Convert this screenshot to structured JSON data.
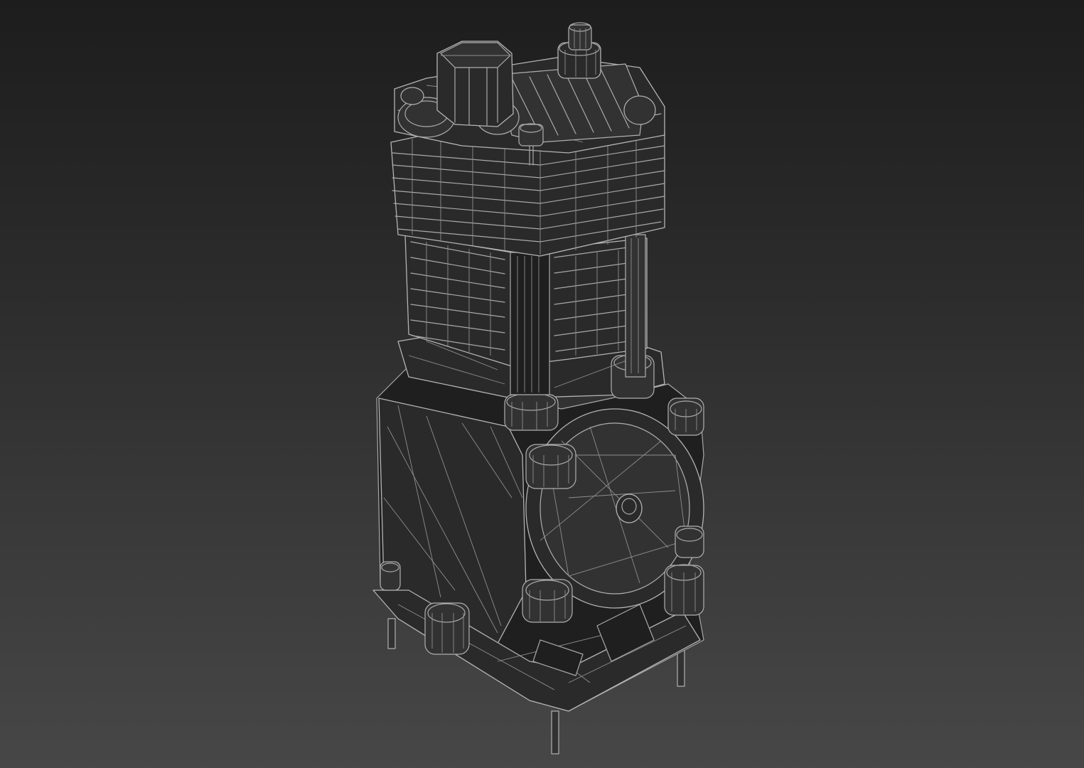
{
  "scene": {
    "subject": "compressor-wireframe",
    "colors": {
      "background_top": "#1d1d1d",
      "background_bottom": "#474747",
      "wire": "#a9a9a9",
      "body_fill": "#2a2a2a"
    }
  }
}
